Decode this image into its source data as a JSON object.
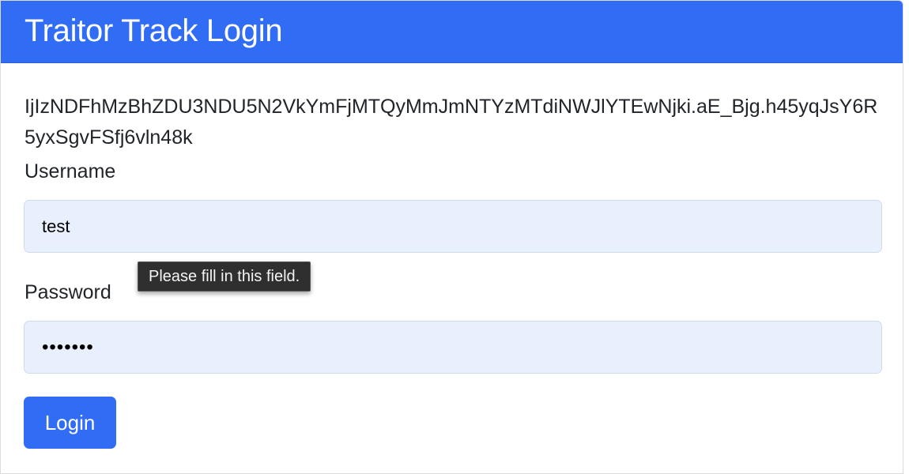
{
  "header": {
    "title": "Traitor Track Login"
  },
  "form": {
    "csrf_token": "IjIzNDFhMzBhZDU3NDU5N2VkYmFjMTQyMmJmNTYzMTdiNWJlYTEwNjki.aE_Bjg.h45yqJsY6R5yxSgvFSfj6vln48k",
    "username_label": "Username",
    "username_value": "test",
    "password_label": "Password",
    "password_value": "•••••••",
    "submit_label": "Login"
  },
  "tooltip": {
    "text": "Please fill in this field."
  },
  "colors": {
    "header_bg": "#316cf4",
    "button_bg": "#316cf4",
    "input_bg": "#e8f0fe",
    "tooltip_bg": "#2f2f2f"
  }
}
